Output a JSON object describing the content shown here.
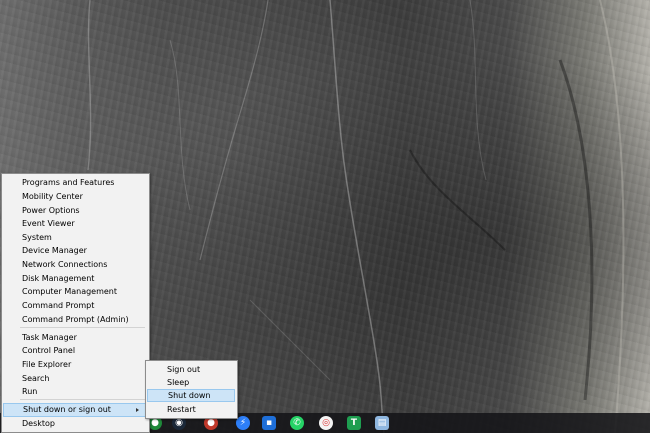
{
  "desktop": {
    "wallpaper": "rock-cliff"
  },
  "winx_menu": {
    "items": [
      {
        "label": "Programs and Features"
      },
      {
        "label": "Mobility Center"
      },
      {
        "label": "Power Options"
      },
      {
        "label": "Event Viewer"
      },
      {
        "label": "System"
      },
      {
        "label": "Device Manager"
      },
      {
        "label": "Network Connections"
      },
      {
        "label": "Disk Management"
      },
      {
        "label": "Computer Management"
      },
      {
        "label": "Command Prompt"
      },
      {
        "label": "Command Prompt (Admin)"
      },
      {
        "label": "Task Manager"
      },
      {
        "label": "Control Panel"
      },
      {
        "label": "File Explorer"
      },
      {
        "label": "Search"
      },
      {
        "label": "Run"
      },
      {
        "label": "Shut down or sign out"
      },
      {
        "label": "Desktop"
      }
    ],
    "highlighted": "Shut down or sign out"
  },
  "shutdown_submenu": {
    "items": [
      {
        "label": "Sign out"
      },
      {
        "label": "Sleep"
      },
      {
        "label": "Shut down"
      },
      {
        "label": "Restart"
      }
    ],
    "highlighted": "Shut down"
  },
  "taskbar": {
    "icons": [
      {
        "name": "green-app-icon",
        "color": "#1f8a3a"
      },
      {
        "name": "steam-icon",
        "color": "#1b2838"
      },
      {
        "name": "red-app-icon",
        "color": "#c0392b"
      },
      {
        "name": "messenger-icon",
        "color": "#2d7ff9"
      },
      {
        "name": "blue-app-icon",
        "color": "#1e6fd9"
      },
      {
        "name": "whatsapp-icon",
        "color": "#25d366"
      },
      {
        "name": "chrome-icon",
        "color": "#f4f4f4"
      },
      {
        "name": "green-t-app-icon",
        "color": "#1e9e50"
      },
      {
        "name": "notepad-icon",
        "color": "#8fb7e0"
      }
    ]
  },
  "accent_colors": {
    "menu_background": "#f2f2f2",
    "highlight": "#cde4f7",
    "highlight_border": "#99c8ee"
  }
}
